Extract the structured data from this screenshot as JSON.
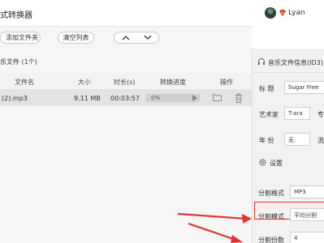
{
  "app": {
    "title": "式转换器"
  },
  "user": {
    "name": "Lyan"
  },
  "toolbar": {
    "add_folder": "添加文件夹",
    "clear_list": "清空列表"
  },
  "list": {
    "title": "乐文件 (1个)",
    "columns": {
      "name": "文件名",
      "size": "大小",
      "duration": "时长(s)",
      "progress": "转换进度",
      "action": "操作"
    },
    "rows": [
      {
        "name": "(2).mp3",
        "size": "9.11 MB",
        "duration": "00:03:57",
        "progress": "0%"
      }
    ]
  },
  "meta": {
    "title": "音乐文件信息(ID3)",
    "title_label": "标 题",
    "title_value": "Sugar Free",
    "artist_label": "艺术家",
    "artist_value": "T-ara",
    "album_label": "专",
    "year_label": "年 份",
    "year_value": "无",
    "genre_label": "流"
  },
  "settings": {
    "label": "设置",
    "format_label": "分割格式",
    "format_value": "MP3",
    "mode_label": "分割模式",
    "mode_value": "平均分割",
    "count_label": "分割份数",
    "count_value": "4"
  },
  "colors": {
    "highlight": "#e8332c",
    "accent": "#333333"
  }
}
